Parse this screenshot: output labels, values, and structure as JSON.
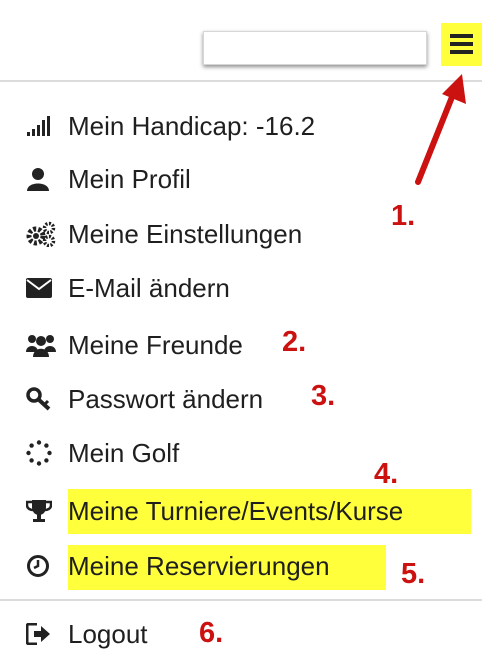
{
  "search": {
    "value": "",
    "placeholder": ""
  },
  "menu": {
    "items": [
      {
        "label": "Mein Handicap: -16.2",
        "icon": "signal-bars-icon"
      },
      {
        "label": "Mein Profil",
        "icon": "user-icon"
      },
      {
        "label": "Meine Einstellungen",
        "icon": "cogs-icon"
      },
      {
        "label": "E-Mail ändern",
        "icon": "envelope-icon"
      },
      {
        "label": "Meine Freunde",
        "icon": "users-icon"
      },
      {
        "label": "Passwort ändern",
        "icon": "key-icon"
      },
      {
        "label": "Mein Golf",
        "icon": "dotted-circle-icon"
      },
      {
        "label": "Meine Turniere/Events/Kurse",
        "icon": "trophy-icon"
      },
      {
        "label": "Meine Reservierungen",
        "icon": "clock-icon"
      }
    ],
    "logout": {
      "label": "Logout",
      "icon": "sign-out-icon"
    }
  },
  "annotations": [
    "1.",
    "2.",
    "3.",
    "4.",
    "5.",
    "6."
  ],
  "colors": {
    "highlight": "#ffff3c",
    "annotation": "#cc1111",
    "text": "#1f1f1f",
    "divider": "#dcdcdc"
  }
}
